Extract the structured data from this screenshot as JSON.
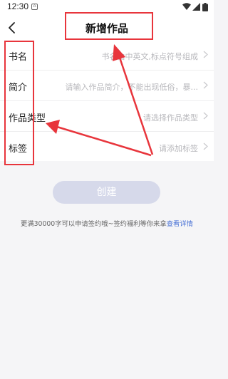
{
  "status_bar": {
    "time": "12:30",
    "app_icon_letter": "A",
    "icons": [
      "wifi-icon",
      "signal-icon",
      "battery-icon"
    ]
  },
  "header": {
    "title": "新增作品",
    "back_icon": "chevron-left-icon"
  },
  "form": {
    "rows": [
      {
        "label": "书名",
        "placeholder": "书名由中英文,标点符号组成"
      },
      {
        "label": "简介",
        "placeholder": "请输入作品简介，不能出现低俗，暴..."
      },
      {
        "label": "作品类型",
        "placeholder": "请选择作品类型"
      },
      {
        "label": "标签",
        "placeholder": "请添加标签"
      }
    ]
  },
  "create_button_label": "创建",
  "hint": {
    "text": "更满30000字可以申请签约哦~签约福利等你来拿",
    "link": "查看详情"
  },
  "colors": {
    "annotation": "#e8353c",
    "button_disabled": "#d6d9ea",
    "link": "#4a72d6"
  }
}
